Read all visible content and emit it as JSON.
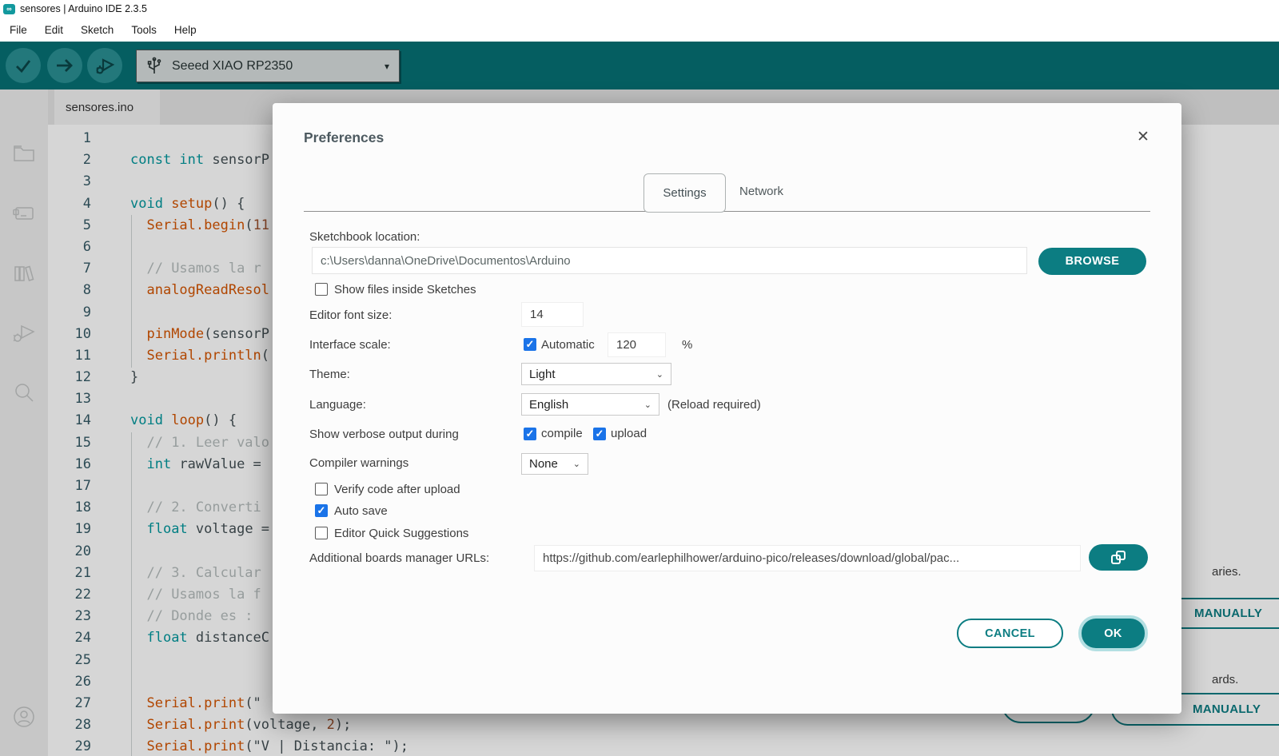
{
  "titlebar": {
    "title": "sensores | Arduino IDE 2.3.5",
    "logo": "arduino-logo"
  },
  "menubar": {
    "items": [
      "File",
      "Edit",
      "Sketch",
      "Tools",
      "Help"
    ]
  },
  "toolbar": {
    "buttons": [
      "verify",
      "upload",
      "debug"
    ],
    "board_selector": {
      "icon": "usb-icon",
      "label": "Seeed XIAO RP2350",
      "caret": "▾"
    }
  },
  "editor_tabs": {
    "active": "sensores.ino"
  },
  "sidebar": {
    "icons": [
      "sketchbook-folder",
      "boards-manager",
      "library-manager",
      "debug",
      "search",
      "account"
    ]
  },
  "editor": {
    "lines": [
      {
        "n": 1,
        "tokens": []
      },
      {
        "n": 2,
        "tokens": [
          {
            "c": "kw",
            "t": "const int"
          },
          {
            "c": "pl",
            "t": " sensorP"
          }
        ]
      },
      {
        "n": 3,
        "tokens": []
      },
      {
        "n": 4,
        "tokens": [
          {
            "c": "kw",
            "t": "void"
          },
          {
            "c": "pl",
            "t": " "
          },
          {
            "c": "fn",
            "t": "setup"
          },
          {
            "c": "pl",
            "t": "() {"
          }
        ]
      },
      {
        "n": 5,
        "tokens": [
          {
            "c": "pl",
            "t": "  "
          },
          {
            "c": "fn",
            "t": "Serial.begin"
          },
          {
            "c": "pl",
            "t": "("
          },
          {
            "c": "num",
            "t": "11"
          }
        ]
      },
      {
        "n": 6,
        "tokens": []
      },
      {
        "n": 7,
        "tokens": [
          {
            "c": "pl",
            "t": "  "
          },
          {
            "c": "cm",
            "t": "// Usamos la r"
          }
        ]
      },
      {
        "n": 8,
        "tokens": [
          {
            "c": "pl",
            "t": "  "
          },
          {
            "c": "fn",
            "t": "analogReadResol"
          }
        ]
      },
      {
        "n": 9,
        "tokens": []
      },
      {
        "n": 10,
        "tokens": [
          {
            "c": "pl",
            "t": "  "
          },
          {
            "c": "fn",
            "t": "pinMode"
          },
          {
            "c": "pl",
            "t": "(sensorP"
          }
        ]
      },
      {
        "n": 11,
        "tokens": [
          {
            "c": "pl",
            "t": "  "
          },
          {
            "c": "fn",
            "t": "Serial.println"
          },
          {
            "c": "pl",
            "t": "("
          }
        ]
      },
      {
        "n": 12,
        "tokens": [
          {
            "c": "pl",
            "t": "}"
          }
        ]
      },
      {
        "n": 13,
        "tokens": []
      },
      {
        "n": 14,
        "tokens": [
          {
            "c": "kw",
            "t": "void"
          },
          {
            "c": "pl",
            "t": " "
          },
          {
            "c": "fn",
            "t": "loop"
          },
          {
            "c": "pl",
            "t": "() {"
          }
        ]
      },
      {
        "n": 15,
        "tokens": [
          {
            "c": "pl",
            "t": "  "
          },
          {
            "c": "cm",
            "t": "// 1. Leer valo"
          }
        ]
      },
      {
        "n": 16,
        "tokens": [
          {
            "c": "pl",
            "t": "  "
          },
          {
            "c": "kw",
            "t": "int"
          },
          {
            "c": "pl",
            "t": " rawValue = "
          }
        ]
      },
      {
        "n": 17,
        "tokens": []
      },
      {
        "n": 18,
        "tokens": [
          {
            "c": "pl",
            "t": "  "
          },
          {
            "c": "cm",
            "t": "// 2. Converti"
          }
        ]
      },
      {
        "n": 19,
        "tokens": [
          {
            "c": "pl",
            "t": "  "
          },
          {
            "c": "kw",
            "t": "float"
          },
          {
            "c": "pl",
            "t": " voltage = "
          }
        ]
      },
      {
        "n": 20,
        "tokens": []
      },
      {
        "n": 21,
        "tokens": [
          {
            "c": "pl",
            "t": "  "
          },
          {
            "c": "cm",
            "t": "// 3. Calcular"
          }
        ]
      },
      {
        "n": 22,
        "tokens": [
          {
            "c": "pl",
            "t": "  "
          },
          {
            "c": "cm",
            "t": "// Usamos la f"
          }
        ]
      },
      {
        "n": 23,
        "tokens": [
          {
            "c": "pl",
            "t": "  "
          },
          {
            "c": "cm",
            "t": "// Donde es : "
          }
        ]
      },
      {
        "n": 24,
        "tokens": [
          {
            "c": "pl",
            "t": "  "
          },
          {
            "c": "kw",
            "t": "float"
          },
          {
            "c": "pl",
            "t": " distanceC"
          }
        ]
      },
      {
        "n": 25,
        "tokens": []
      },
      {
        "n": 26,
        "tokens": []
      },
      {
        "n": 27,
        "tokens": [
          {
            "c": "pl",
            "t": "  "
          },
          {
            "c": "fn",
            "t": "Serial.print"
          },
          {
            "c": "pl",
            "t": "(\""
          }
        ]
      },
      {
        "n": 28,
        "tokens": [
          {
            "c": "pl",
            "t": "  "
          },
          {
            "c": "fn",
            "t": "Serial.print"
          },
          {
            "c": "pl",
            "t": "(voltage, "
          },
          {
            "c": "num",
            "t": "2"
          },
          {
            "c": "pl",
            "t": ");"
          }
        ]
      },
      {
        "n": 29,
        "tokens": [
          {
            "c": "pl",
            "t": "  "
          },
          {
            "c": "fn",
            "t": "Serial.print"
          },
          {
            "c": "pl",
            "t": "(\"V | Distancia: \");"
          }
        ]
      }
    ]
  },
  "preferences_dialog": {
    "title": "Preferences",
    "close": "✕",
    "tabs": {
      "active": "Settings",
      "inactive": "Network"
    },
    "sketchbook": {
      "label": "Sketchbook location:",
      "value": "c:\\Users\\danna\\OneDrive\\Documentos\\Arduino",
      "browse": "BROWSE"
    },
    "show_files": {
      "label": "Show files inside Sketches",
      "checked": false
    },
    "font_size": {
      "label": "Editor font size:",
      "value": "14"
    },
    "interface_scale": {
      "label": "Interface scale:",
      "auto_label": "Automatic",
      "auto_checked": true,
      "value": "120",
      "unit": "%"
    },
    "theme": {
      "label": "Theme:",
      "value": "Light",
      "caret": "⌄"
    },
    "language": {
      "label": "Language:",
      "value": "English",
      "caret": "⌄",
      "note": "(Reload required)"
    },
    "verbose": {
      "label": "Show verbose output during",
      "compile_label": "compile",
      "compile_checked": true,
      "upload_label": "upload",
      "upload_checked": true
    },
    "compiler_warnings": {
      "label": "Compiler warnings",
      "value": "None",
      "caret": "⌄"
    },
    "verify_code": {
      "label": "Verify code after upload",
      "checked": false
    },
    "auto_save": {
      "label": "Auto save",
      "checked": true
    },
    "quick_suggestions": {
      "label": "Editor Quick Suggestions",
      "checked": false
    },
    "boards_urls": {
      "label": "Additional boards manager URLs:",
      "value": "https://github.com/earlephilhower/arduino-pico/releases/download/global/pac..."
    },
    "cancel": "CANCEL",
    "ok": "OK"
  },
  "background_fragments": {
    "libraries_text": "aries.",
    "boards_text": "ards.",
    "install_button_top": "MANUALLY",
    "install_button_bottom": "MANUALLY"
  },
  "colors": {
    "toolbar_teal": "#077074",
    "accent_teal": "#0c7d82",
    "checkbox_blue": "#1a73e8"
  }
}
